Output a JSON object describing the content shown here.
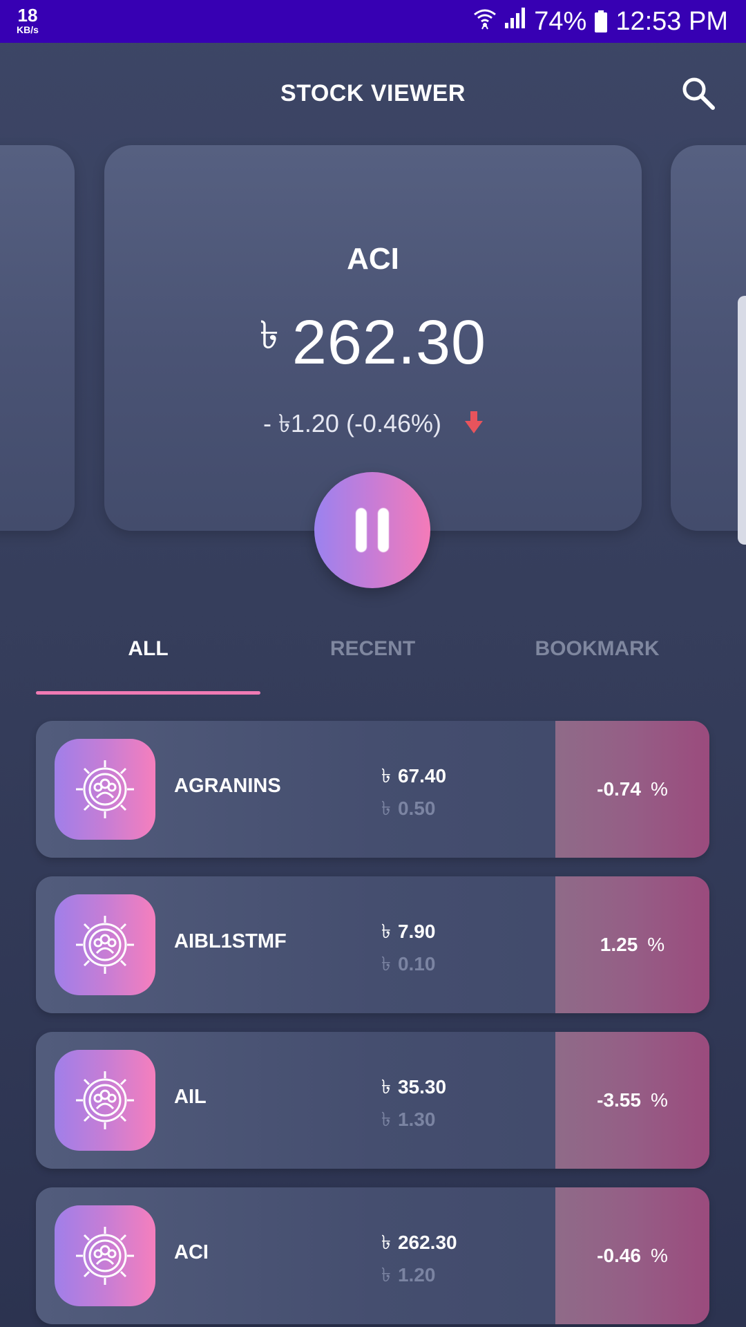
{
  "status_bar": {
    "net_speed": "18",
    "net_unit": "KB/s",
    "battery": "74%",
    "time": "12:53 PM"
  },
  "header": {
    "title": "STOCK VIEWER",
    "search_icon": "search-icon"
  },
  "featured": {
    "symbol": "ACI",
    "currency": "৳",
    "price": "262.30",
    "change_text": "- ৳1.20 (-0.46%)",
    "trend_icon": "arrow-down-icon",
    "control_icon": "pause-icon"
  },
  "tabs": [
    {
      "label": "ALL",
      "active": true
    },
    {
      "label": "RECENT",
      "active": false
    },
    {
      "label": "BOOKMARK",
      "active": false
    }
  ],
  "stocks": [
    {
      "symbol": "AGRANINS",
      "currency": "৳",
      "price": "67.40",
      "change": "0.50",
      "percent": "-0.74",
      "pct_sign": "%"
    },
    {
      "symbol": "AIBL1STMF",
      "currency": "৳",
      "price": "7.90",
      "change": "0.10",
      "percent": "1.25",
      "pct_sign": "%"
    },
    {
      "symbol": "AIL",
      "currency": "৳",
      "price": "35.30",
      "change": "1.30",
      "percent": "-3.55",
      "pct_sign": "%"
    },
    {
      "symbol": "ACI",
      "currency": "৳",
      "price": "262.30",
      "change": "1.20",
      "percent": "-0.46",
      "pct_sign": "%"
    }
  ],
  "colors": {
    "status_bar": "#3700b3",
    "accent_pink": "#f07ab4",
    "accent_purple": "#9b82ef",
    "down_red": "#e8545c"
  }
}
